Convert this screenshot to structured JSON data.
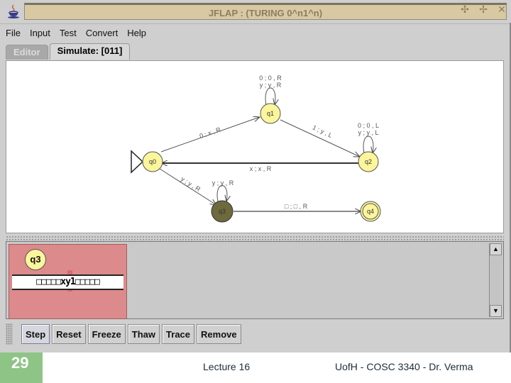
{
  "window": {
    "title": "JFLAP : (TURING 0^n1^n)",
    "controls": [
      "minimize",
      "maximize",
      "close"
    ]
  },
  "menu": [
    "File",
    "Input",
    "Test",
    "Convert",
    "Help"
  ],
  "tabs": [
    {
      "label": "Editor",
      "active": false
    },
    {
      "label": "Simulate: [011]",
      "active": true
    }
  ],
  "automaton": {
    "states": [
      {
        "id": "q0",
        "label": "q0",
        "initial": true,
        "final": false,
        "highlighted": false
      },
      {
        "id": "q1",
        "label": "q1",
        "initial": false,
        "final": false,
        "highlighted": false
      },
      {
        "id": "q2",
        "label": "q2",
        "initial": false,
        "final": false,
        "highlighted": false
      },
      {
        "id": "q3",
        "label": "q3",
        "initial": false,
        "final": false,
        "highlighted": true
      },
      {
        "id": "q4",
        "label": "q4",
        "initial": false,
        "final": true,
        "highlighted": false
      }
    ],
    "transitions": [
      {
        "from": "q0",
        "to": "q1",
        "label": "0 ; x , R"
      },
      {
        "from": "q1",
        "to": "q1",
        "label": "0 ; 0 , R"
      },
      {
        "from": "q1",
        "to": "q1",
        "label": "y ; y , R"
      },
      {
        "from": "q1",
        "to": "q2",
        "label": "1 ; y , L"
      },
      {
        "from": "q2",
        "to": "q2",
        "label": "0 ; 0 , L"
      },
      {
        "from": "q2",
        "to": "q2",
        "label": "y ; y , L"
      },
      {
        "from": "q2",
        "to": "q0",
        "label": "x ; x , R"
      },
      {
        "from": "q0",
        "to": "q3",
        "label": "y ; y , R"
      },
      {
        "from": "q3",
        "to": "q3",
        "label": "y ; y , R"
      },
      {
        "from": "q3",
        "to": "q4",
        "label": "□ ; □ , R"
      }
    ]
  },
  "configuration": {
    "state": "q3",
    "tape": "□□□□□xy1□□□□□",
    "head_symbol": "1"
  },
  "buttons": [
    "Step",
    "Reset",
    "Freeze",
    "Thaw",
    "Trace",
    "Remove"
  ],
  "slide": {
    "number": "29",
    "lecture": "Lecture 16",
    "course": "UofH - COSC 3340 - Dr. Verma"
  },
  "colors": {
    "state_fill": "#fbf59c",
    "highlight_state_fill": "#6e6a3e",
    "config_bg": "#dc8a8b",
    "titlebar": "#d9c9a2",
    "slide_number_bg": "#8ec486"
  }
}
